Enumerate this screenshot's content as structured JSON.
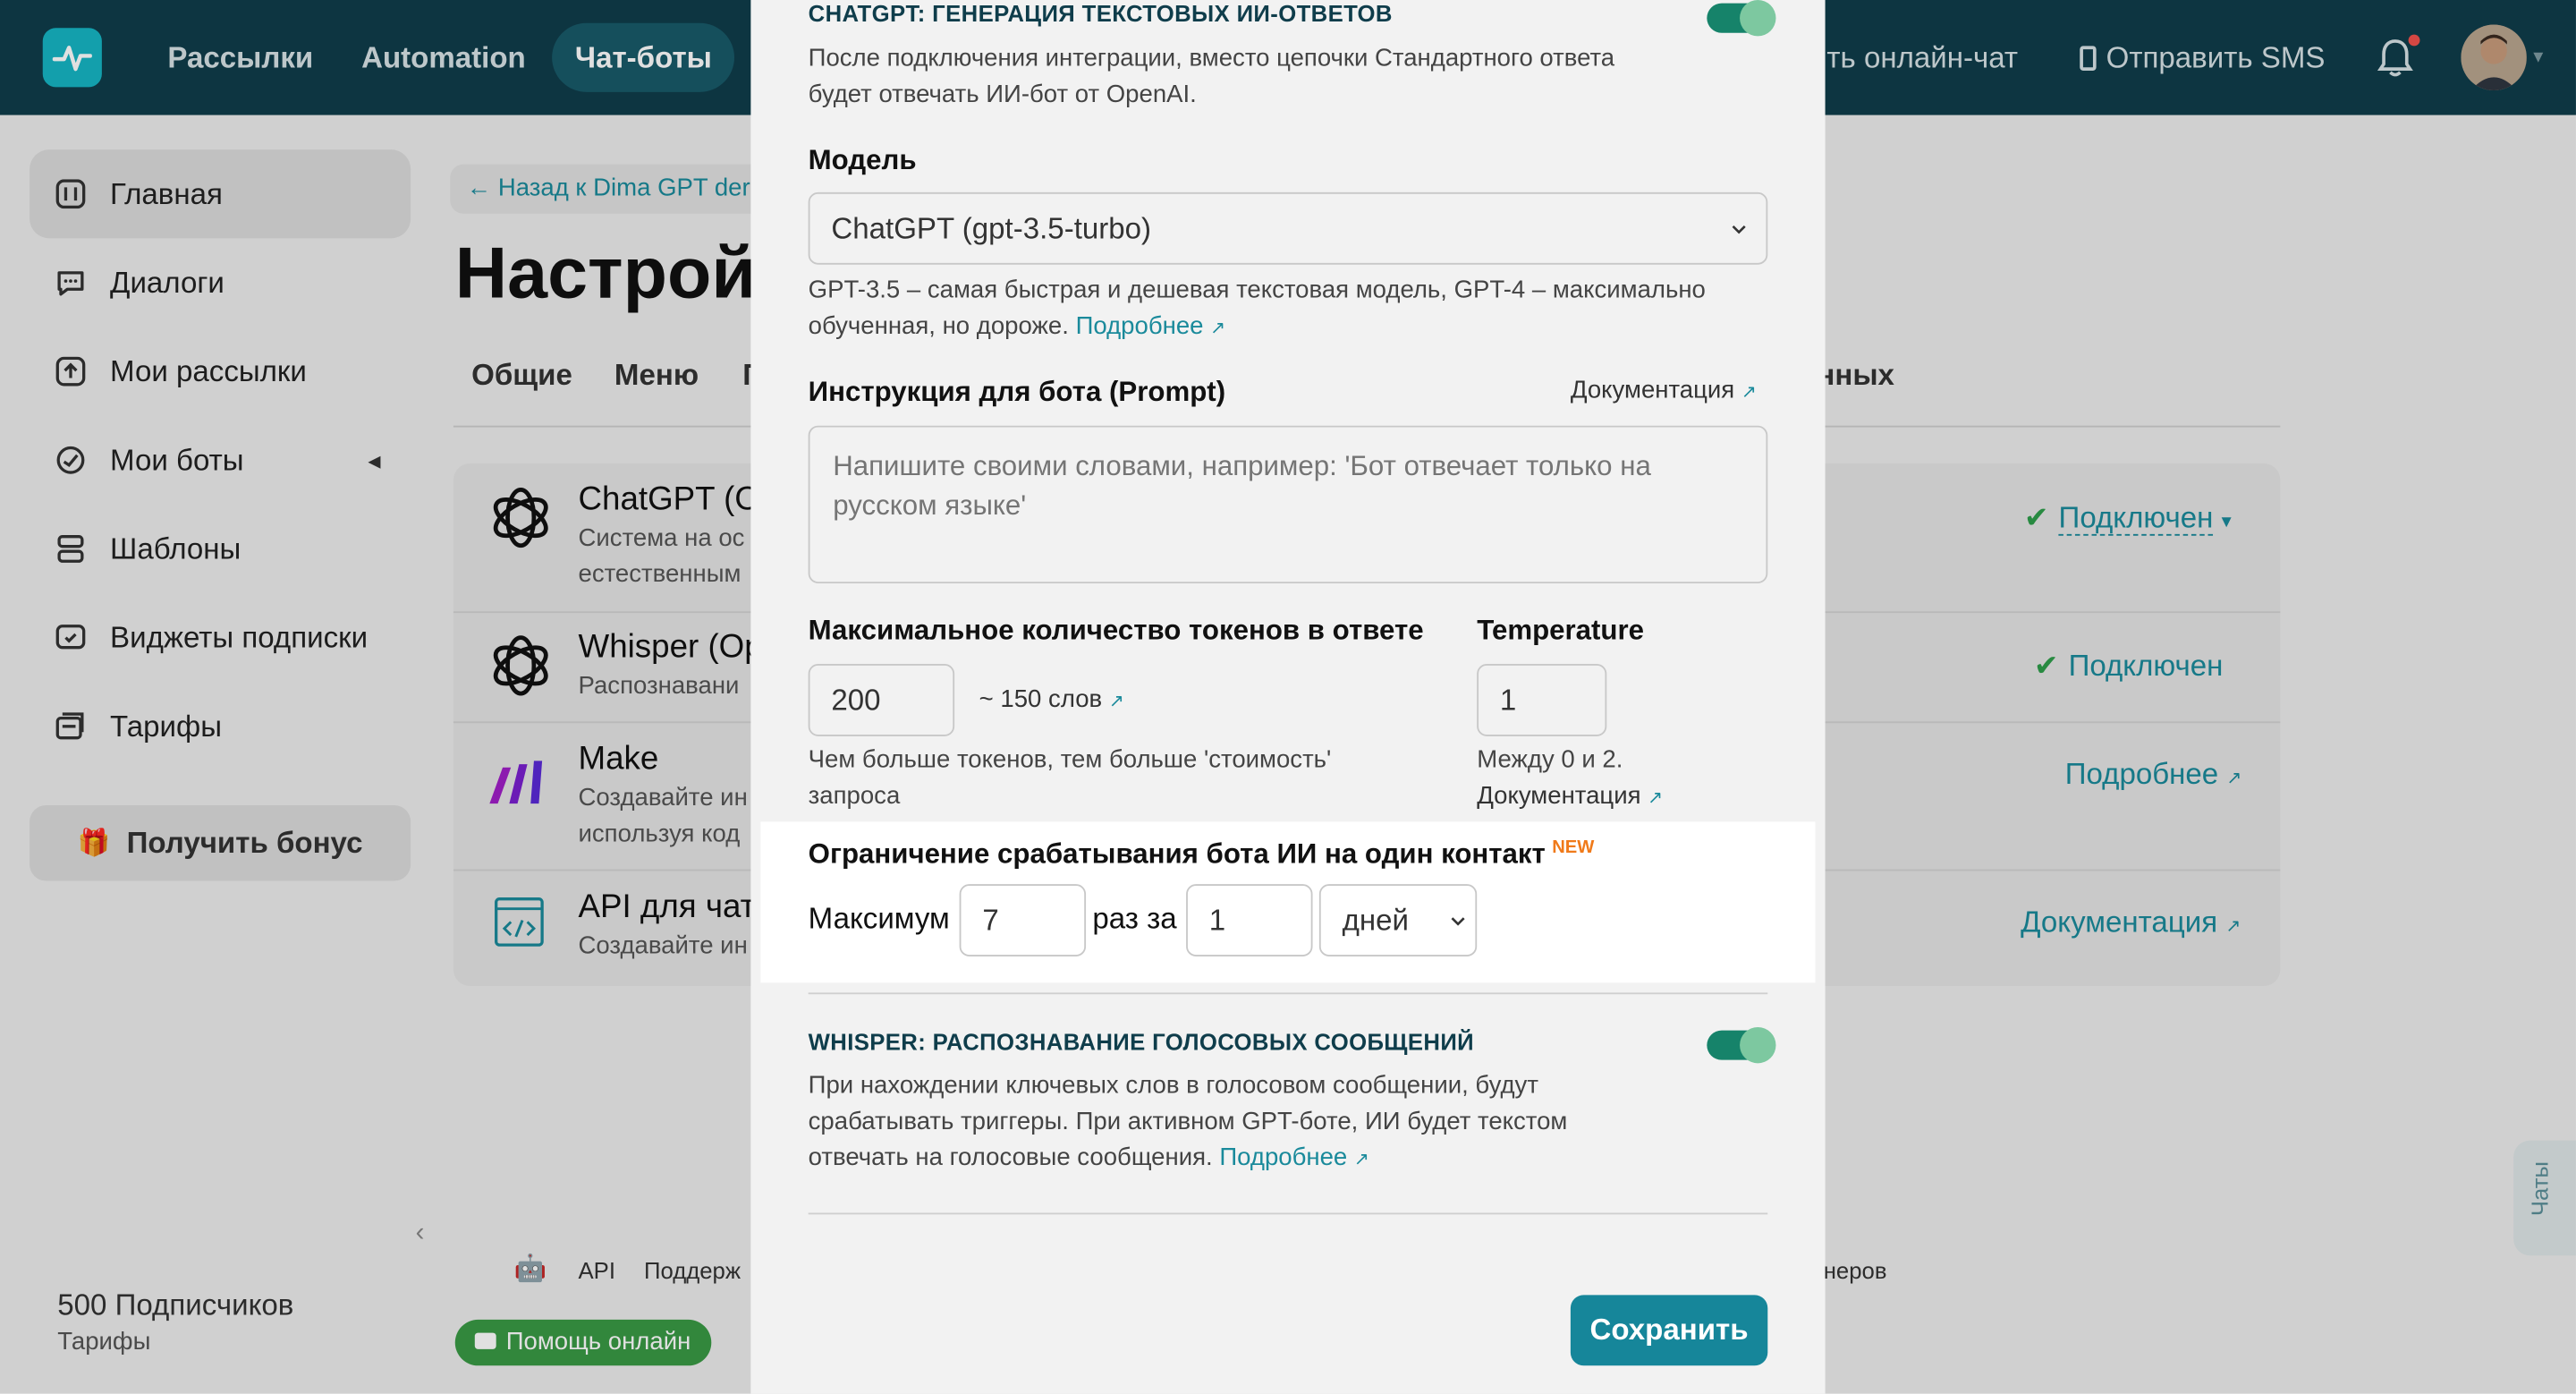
{
  "topbar": {
    "nav": [
      "Рассылки",
      "Automation",
      "Чат-боты"
    ],
    "online_chat": "ть онлайн-чат",
    "send_sms": "Отправить SMS"
  },
  "sidebar": {
    "items": [
      {
        "label": "Главная",
        "icon": "home-icon"
      },
      {
        "label": "Диалоги",
        "icon": "chat-icon"
      },
      {
        "label": "Мои рассылки",
        "icon": "upload-icon"
      },
      {
        "label": "Мои боты",
        "icon": "bot-icon"
      },
      {
        "label": "Шаблоны",
        "icon": "templates-icon"
      },
      {
        "label": "Виджеты подписки",
        "icon": "widget-icon"
      },
      {
        "label": "Тарифы",
        "icon": "tariff-icon"
      }
    ],
    "bonus": "Получить бонус",
    "subscribers": "500 Подписчиков",
    "tariffs": "Тарифы"
  },
  "background": {
    "breadcrumb": "← Назад к Dima GPT der",
    "title": "Настрой",
    "tabs": [
      "Общие",
      "Меню",
      "П"
    ],
    "tab_right": "нных",
    "integrations": [
      {
        "title": "ChatGPT (O",
        "desc1": "Система на ос",
        "desc2": "естественным",
        "status": "Подключен"
      },
      {
        "title": "Whisper (Op",
        "desc1": "Распознавани",
        "status": "Подключен"
      },
      {
        "title": "Make",
        "desc1": "Создавайте ин",
        "desc2": "используя код",
        "status": "Подробнее"
      },
      {
        "title": "API для чат",
        "desc1": "Создавайте ин",
        "status": "Документация"
      }
    ],
    "footer": {
      "api": "API",
      "support": "Поддерж",
      "partners": "неров",
      "help": "Помощь онлайн"
    },
    "chats_tab": "Чаты"
  },
  "modal": {
    "chatgpt": {
      "title": "CHATGPT: ГЕНЕРАЦИЯ ТЕКСТОВЫХ ИИ-ОТВЕТОВ",
      "desc1": "После подключения интеграции, вместо цепочки Стандартного ответа",
      "desc2": "будет отвечать ИИ-бот от OpenAI.",
      "enabled": true
    },
    "model": {
      "label": "Модель",
      "value": "ChatGPT (gpt-3.5-turbo)",
      "hint1": "GPT-3.5 – самая быстрая и дешевая текстовая модель, GPT-4 – максимально",
      "hint2": "обученная, но дороже.",
      "more": "Подробнее"
    },
    "prompt": {
      "label": "Инструкция для бота (Prompt)",
      "docs": "Документация",
      "placeholder": "Напишите своими словами, например: 'Бот отвечает только на русском языке'"
    },
    "tokens": {
      "label": "Максимальное количество токенов в ответе",
      "value": "200",
      "words": "~ 150 слов",
      "hint1": "Чем больше токенов, тем больше 'стоимость'",
      "hint2": "запроса"
    },
    "temperature": {
      "label": "Temperature",
      "value": "1",
      "hint": "Между 0 и 2.",
      "docs": "Документация"
    },
    "limit": {
      "label": "Ограничение срабатывания бота ИИ на один контакт",
      "badge": "NEW",
      "max_label": "Максимум",
      "max_value": "7",
      "per_label": "раз за",
      "period_value": "1",
      "unit": "дней"
    },
    "whisper": {
      "title": "WHISPER: РАСПОЗНАВАНИЕ ГОЛОСОВЫХ СООБЩЕНИЙ",
      "desc1": "При нахождении ключевых слов в голосовом сообщении, будут",
      "desc2": "срабатывать триггеры. При активном GPT-боте, ИИ будет текстом",
      "desc3": "отвечать на голосовые сообщения.",
      "more": "Подробнее",
      "enabled": true
    },
    "save": "Сохранить"
  }
}
